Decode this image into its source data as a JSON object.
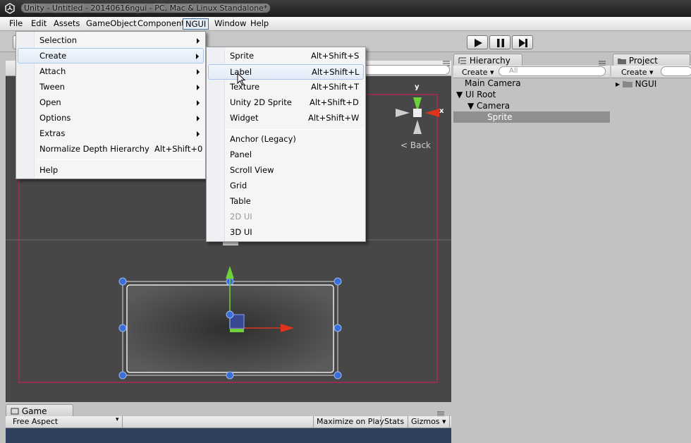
{
  "window": {
    "title": "Unity - Untitled - 20140616ngui - PC, Mac & Linux Standalone*"
  },
  "menubar": [
    "File",
    "Edit",
    "Assets",
    "GameObject",
    "Component",
    "NGUI",
    "Window",
    "Help"
  ],
  "ngui_menu": {
    "items": [
      {
        "label": "Selection",
        "submenu": true
      },
      {
        "label": "Create",
        "submenu": true,
        "active": true
      },
      {
        "label": "Attach",
        "submenu": true
      },
      {
        "label": "Tween",
        "submenu": true
      },
      {
        "label": "Open",
        "submenu": true
      },
      {
        "label": "Options",
        "submenu": true
      },
      {
        "label": "Extras",
        "submenu": true
      },
      {
        "label": "Normalize Depth Hierarchy",
        "shortcut": "Alt+Shift+0"
      },
      {
        "label": "Help"
      }
    ]
  },
  "create_submenu": {
    "items": [
      {
        "label": "Sprite",
        "shortcut": "Alt+Shift+S"
      },
      {
        "label": "Label",
        "shortcut": "Alt+Shift+L",
        "hover": true
      },
      {
        "label": "Texture",
        "shortcut": "Alt+Shift+T"
      },
      {
        "label": "Unity 2D Sprite",
        "shortcut": "Alt+Shift+D"
      },
      {
        "label": "Widget",
        "shortcut": "Alt+Shift+W"
      },
      {
        "label": "Anchor (Legacy)"
      },
      {
        "label": "Panel"
      },
      {
        "label": "Scroll View"
      },
      {
        "label": "Grid"
      },
      {
        "label": "Table"
      },
      {
        "label": "2D UI",
        "disabled": true
      },
      {
        "label": "3D UI"
      }
    ]
  },
  "scene": {
    "gizmo_y": "y",
    "gizmo_x": "x",
    "back_label": "Back"
  },
  "hierarchy": {
    "tab": "Hierarchy",
    "create_label": "Create",
    "search_placeholder": "All",
    "items": [
      {
        "label": "Main Camera"
      },
      {
        "label": "UI Root",
        "expanded": true
      },
      {
        "label": "Camera",
        "expanded": true
      },
      {
        "label": "Sprite",
        "selected": true
      }
    ]
  },
  "project": {
    "tab": "Project",
    "create_label": "Create",
    "items": [
      {
        "label": "NGUI"
      }
    ]
  },
  "game": {
    "tab": "Game",
    "aspect": "Free Aspect",
    "maximize": "Maximize on Play",
    "stats": "Stats",
    "gizmos": "Gizmos"
  },
  "colors": {
    "scene_bg": "#474747",
    "selection_rect": "#c81e5a",
    "handle_blue": "#3b6fd8",
    "axis_green": "#6fd13a",
    "axis_red": "#e0341c",
    "game_bg": "#30415f"
  }
}
